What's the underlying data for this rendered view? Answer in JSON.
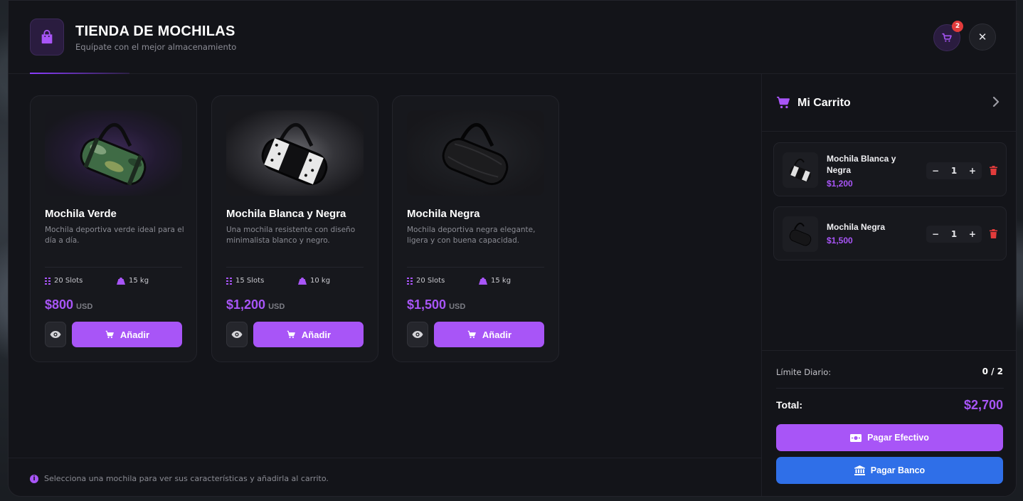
{
  "header": {
    "title": "TIENDA DE MOCHILAS",
    "subtitle": "Equípate con el mejor almacenamiento",
    "cart_count": "2",
    "close_symbol": "✕"
  },
  "products": [
    {
      "name": "Mochila Verde",
      "description": "Mochila deportiva verde ideal para el día a día.",
      "slots": "20 Slots",
      "weight": "15 kg",
      "price": "$800",
      "currency": "USD",
      "add_label": "Añadir",
      "color": "#3f6b45"
    },
    {
      "name": "Mochila Blanca y Negra",
      "description": "Una mochila resistente con diseño minimalista blanco y negro.",
      "slots": "15 Slots",
      "weight": "10 kg",
      "price": "$1,200",
      "currency": "USD",
      "add_label": "Añadir",
      "color": "#e8e8e8"
    },
    {
      "name": "Mochila Negra",
      "description": "Mochila deportiva negra elegante, ligera y con buena capacidad.",
      "slots": "20 Slots",
      "weight": "15 kg",
      "price": "$1,500",
      "currency": "USD",
      "add_label": "Añadir",
      "color": "#2a2a2c"
    }
  ],
  "footer": {
    "info_text": "Selecciona una mochila para ver sus características y añadirla al carrito.",
    "info_symbol": "i"
  },
  "cart": {
    "title": "Mi Carrito",
    "items": [
      {
        "name": "Mochila Blanca y Negra",
        "price": "$1,200",
        "qty": "1"
      },
      {
        "name": "Mochila Negra",
        "price": "$1,500",
        "qty": "1"
      }
    ],
    "qty_minus": "−",
    "qty_plus": "+",
    "limit_label": "Límite Diario:",
    "limit_value": "0 / 2",
    "total_label": "Total:",
    "total_value": "$2,700",
    "pay_cash_label": "Pagar Efectivo",
    "pay_bank_label": "Pagar Banco"
  },
  "colors": {
    "accent": "#a855f7",
    "bank": "#2f6fe8",
    "danger": "#e23b3b",
    "background": "#131419"
  }
}
